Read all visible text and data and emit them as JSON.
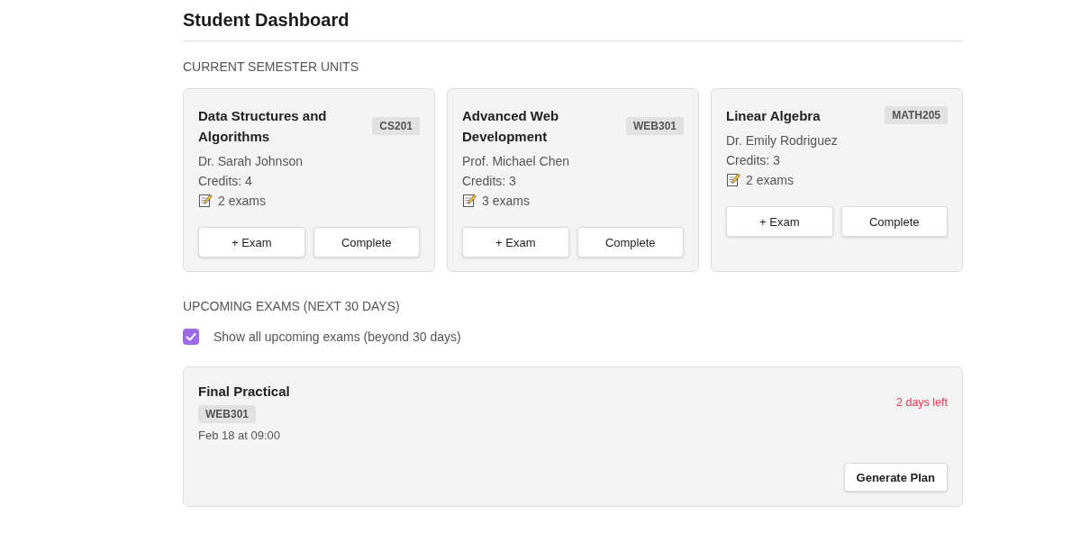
{
  "page": {
    "title": "Student Dashboard"
  },
  "units": {
    "heading": "CURRENT SEMESTER UNITS",
    "cards": [
      {
        "title": "Data Structures and Algorithms",
        "code": "CS201",
        "instructor": "Dr. Sarah Johnson",
        "credits": "Credits: 4",
        "exams": "2 exams",
        "add_button": "+ Exam",
        "complete_button": "Complete"
      },
      {
        "title": "Advanced Web Development",
        "code": "WEB301",
        "instructor": "Prof. Michael Chen",
        "credits": "Credits: 3",
        "exams": "3 exams",
        "add_button": "+ Exam",
        "complete_button": "Complete"
      },
      {
        "title": "Linear Algebra",
        "code": "MATH205",
        "instructor": "Dr. Emily Rodriguez",
        "credits": "Credits: 3",
        "exams": "2 exams",
        "add_button": "+ Exam",
        "complete_button": "Complete"
      }
    ]
  },
  "upcoming": {
    "heading": "UPCOMING EXAMS (NEXT 30 DAYS)",
    "show_all": {
      "label": "Show all upcoming exams (beyond 30 days)",
      "checked": true
    },
    "exams": [
      {
        "title": "Final Practical",
        "code": "WEB301",
        "when": "Feb 18 at 09:00",
        "countdown": "2 days left",
        "urgent": true,
        "button": "Generate Plan"
      }
    ]
  }
}
